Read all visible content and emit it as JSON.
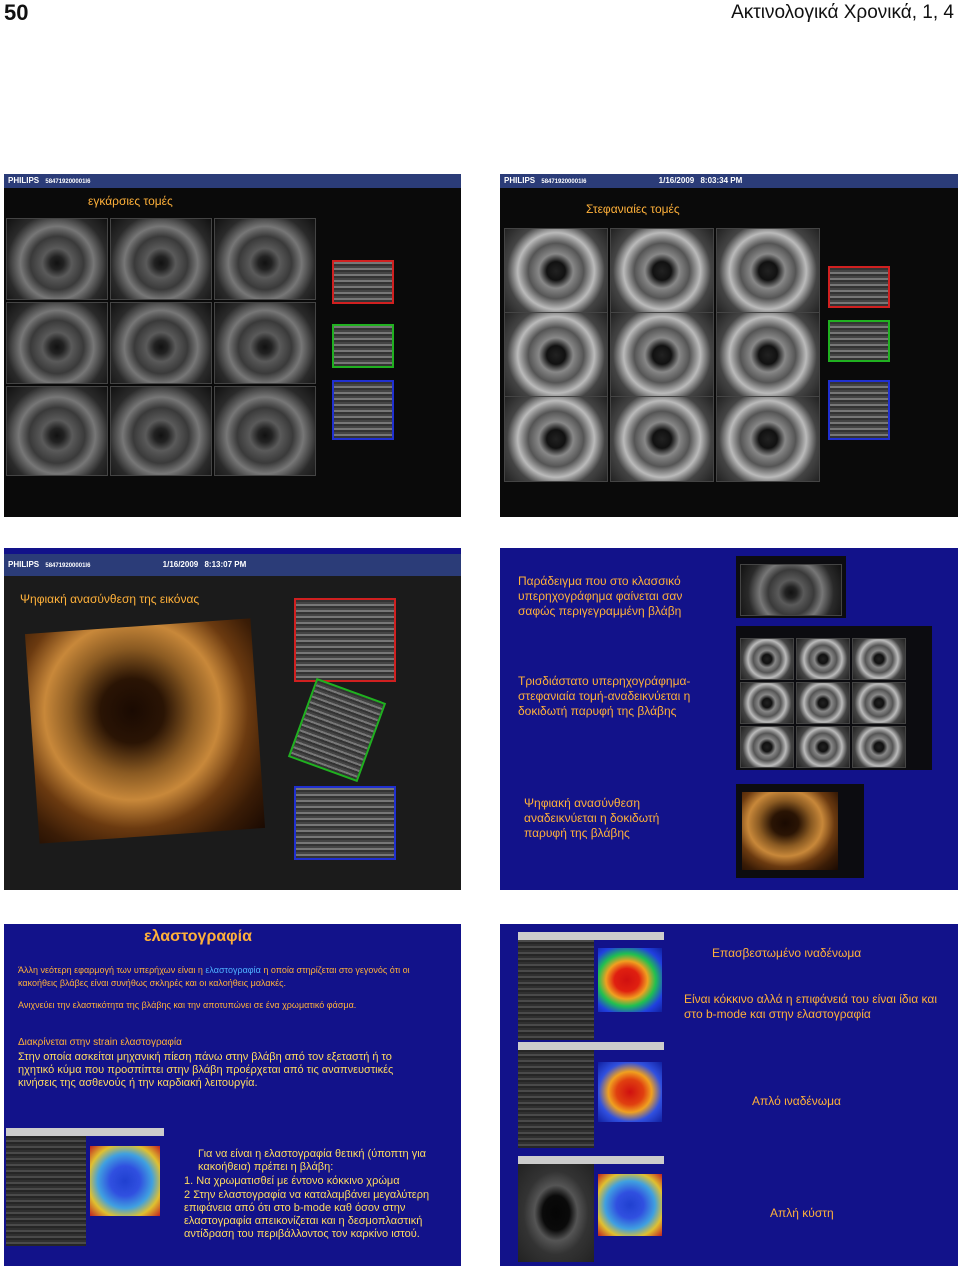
{
  "header": {
    "page_number": "50",
    "journal": "Ακτινολογικά Χρονικά, 1, 4"
  },
  "slides": {
    "s1": {
      "bar_brand": "PHILIPS",
      "bar_id": "584719200001l6",
      "label": "εγκάρσιες τομές"
    },
    "s2": {
      "bar_brand": "PHILIPS",
      "bar_id": "584719200001l6",
      "bar_date": "1/16/2009",
      "bar_time": "8:03:34 PM",
      "label": "Στεφανιαίες τομές"
    },
    "s3": {
      "bar_brand": "PHILIPS",
      "bar_id": "584719200001l6",
      "bar_date": "1/16/2009",
      "bar_time": "8:13:07 PM",
      "label": "Ψηφιακή ανασύνθεση της εικόνας"
    },
    "s4": {
      "text1": "Παράδειγμα που στο κλασσικό υπερηχογράφημα φαίνεται σαν σαφώς περιγεγραμμένη βλάβη",
      "text2": "Τρισδιάστατο υπερηχογράφημα-στεφανιαία τομή-αναδεικνύεται η δοκιδωτή παρυφή της βλάβης",
      "text3": "Ψηφιακή ανασύνθεση αναδεικνύεται η δοκιδωτή παρυφή της βλάβης"
    },
    "s5": {
      "title": "ελαστογραφία",
      "p1_pre": "Άλλη νεότερη εφαρμογή των υπερήχων είναι η ",
      "p1_hl": "ελαστογραφία",
      "p1_post": " η οποία στηρίζεται στο γεγονός ότι οι κακοήθεις βλάβες είναι συνήθως σκληρές και οι καλοήθεις μαλακές.",
      "p2": "Ανιχνεύει την ελαστικότητα της βλάβης και την αποτυπώνει σε ένα χρωματικό φάσμα.",
      "p3": "Διακρίνεται στην strain ελαστογραφία",
      "p4": "Στην οποία ασκείται μηχανική πίεση πάνω στην βλάβη από τον εξεταστή ή το ηχητικό κύμα που προσπίπτει στην βλάβη προέρχεται από τις αναπνευστικές κινήσεις της ασθενούς ή την καρδιακή λειτουργία.",
      "p5": "Για να είναι η ελαστογραφία θετική (ύποπτη για κακοήθεια) πρέπει η βλάβη:",
      "li1_num": "1.",
      "li1": "Να χρωματισθεί με έντονο κόκκινο χρώμα",
      "li2_num": "2",
      "li2": "Στην ελαστογραφία να καταλαμβάνει μεγαλύτερη επιφάνεια από ότι στο b-mode καθ όσον στην ελαστογραφία απεικονίζεται και η δεσμοπλαστική αντίδραση του περιβάλλοντος τον καρκίνο ιστού."
    },
    "s6": {
      "label1": "Επασβεστωμένο ιναδένωμα",
      "label2": "Είναι κόκκινο αλλά η επιφάνειά του είναι ίδια και στο b-mode και στην ελαστογραφία",
      "label3": "Απλό ιναδένωμα",
      "label4": "Απλή κύστη"
    }
  },
  "colors": {
    "slide_blue": "#12128a",
    "orange_text": "#ffb13a",
    "bar_blue": "#2b3c78"
  }
}
